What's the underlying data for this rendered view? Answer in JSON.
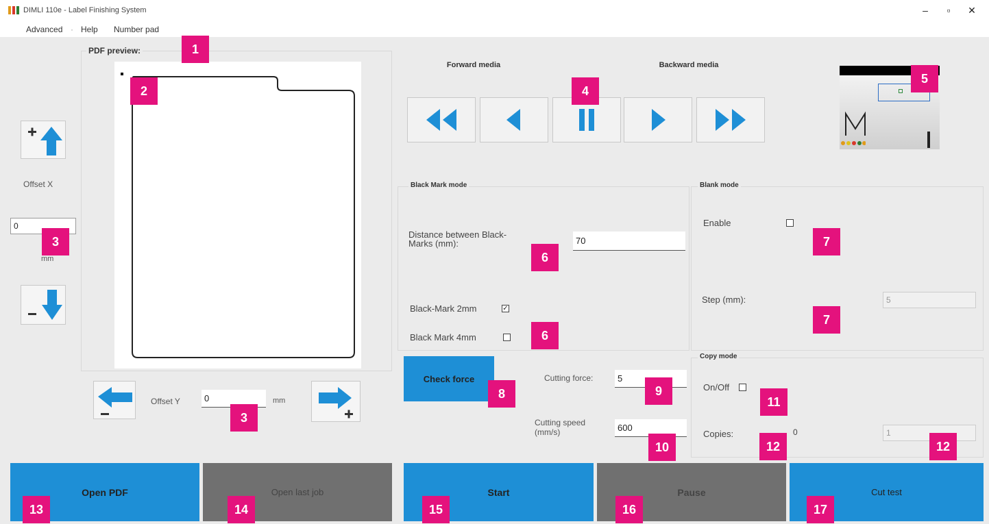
{
  "window": {
    "title": "DIMLI 110e - Label Finishing System",
    "controls": [
      "–",
      "▫",
      "✕"
    ]
  },
  "menu": {
    "items": [
      "Advanced",
      "Help",
      "Number pad"
    ]
  },
  "preview": {
    "label": "PDF preview:"
  },
  "offset_x": {
    "label": "Offset X",
    "value": "0",
    "unit": "mm",
    "up_icon": "plus-up-arrow-icon",
    "down_icon": "minus-down-arrow-icon"
  },
  "offset_y": {
    "label": "Offset Y",
    "value": "0",
    "unit": "mm",
    "left_icon": "minus-left-arrow-icon",
    "right_icon": "plus-right-arrow-icon"
  },
  "media": {
    "forward_label": "Forward media",
    "backward_label": "Backward media",
    "buttons": [
      "fast-rewind-icon",
      "step-back-icon",
      "pause-icon",
      "play-icon",
      "fast-forward-icon"
    ]
  },
  "black_mark": {
    "title": "Black Mark mode",
    "distance_label": "Distance between Black-Marks (mm):",
    "distance_value": "70",
    "mark2_label": "Black-Mark 2mm",
    "mark2_checked": true,
    "mark4_label": "Black Mark 4mm",
    "mark4_checked": false
  },
  "blank_mode": {
    "title": "Blank mode",
    "enable_label": "Enable",
    "enable_checked": false,
    "step_label": "Step (mm):",
    "step_value": "5"
  },
  "cutting": {
    "check_force_label": "Check force",
    "force_label": "Cutting force:",
    "force_value": "5",
    "speed_label": "Cutting speed (mm/s)",
    "speed_value": "600"
  },
  "copy_mode": {
    "title": "Copy mode",
    "onoff_label": "On/Off",
    "onoff_checked": false,
    "copies_label": "Copies:",
    "copies_count": "0",
    "copies_value": "1"
  },
  "actions": {
    "open_pdf": "Open PDF",
    "open_last_job": "Open last job",
    "start": "Start",
    "pause": "Pause",
    "cut_test": "Cut test"
  },
  "callouts": [
    "1",
    "2",
    "3",
    "3",
    "4",
    "5",
    "6",
    "6",
    "7",
    "7",
    "8",
    "9",
    "10",
    "11",
    "12",
    "12",
    "13",
    "14",
    "15",
    "16",
    "17"
  ],
  "colors": {
    "accent_blue": "#1e8fd6",
    "callout_pink": "#e4127d",
    "disabled_gray": "#707070"
  }
}
